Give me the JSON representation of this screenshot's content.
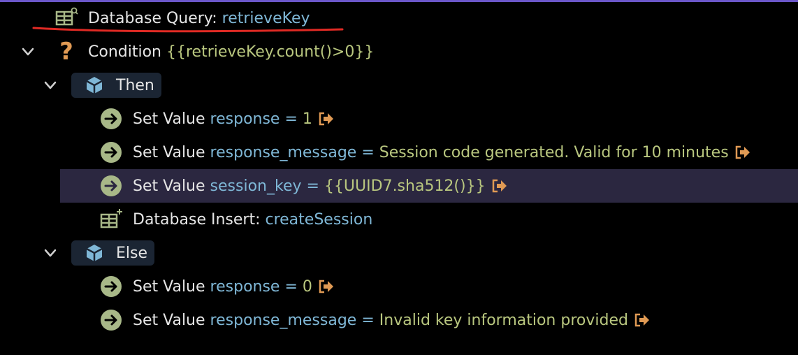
{
  "colors": {
    "background": "#000000",
    "selected_row": "#2b2740",
    "block_bg": "#1b2533",
    "reference": "#7fb7d6",
    "value": "#b9c77f",
    "icon_green": "#a8b888",
    "icon_orange": "#e09a54",
    "annotation_red": "#e02a24"
  },
  "tree": {
    "query": {
      "label": "Database Query:",
      "name": "retrieveKey"
    },
    "condition": {
      "label": "Condition",
      "expr": "{{retrieveKey.count()>0}}"
    },
    "then": {
      "label": "Then",
      "items": [
        {
          "label": "Set Value",
          "var": "response",
          "eq": "=",
          "value": "1"
        },
        {
          "label": "Set Value",
          "var": "response_message",
          "eq": "=",
          "value": "Session code generated. Valid for 10 minutes"
        },
        {
          "label": "Set Value",
          "var": "session_key",
          "eq": "=",
          "value": "{{UUID7.sha512()}}"
        }
      ],
      "insert": {
        "label": "Database Insert:",
        "name": "createSession"
      }
    },
    "else": {
      "label": "Else",
      "items": [
        {
          "label": "Set Value",
          "var": "response",
          "eq": "=",
          "value": "0"
        },
        {
          "label": "Set Value",
          "var": "response_message",
          "eq": "=",
          "value": "Invalid key information provided"
        }
      ]
    }
  }
}
